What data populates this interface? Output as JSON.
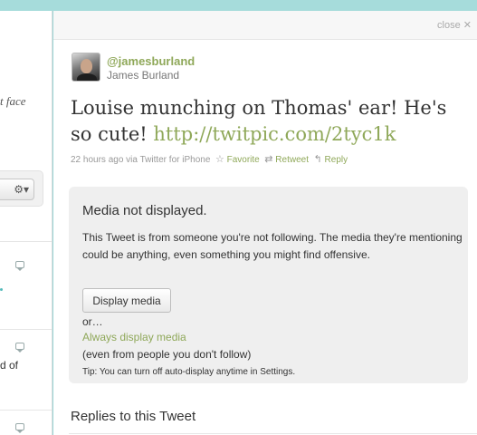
{
  "left_column": {
    "snippet_1": "t face",
    "gear_glyph": "⚙▾",
    "snippet_2": "d of"
  },
  "details": {
    "close_label": "close ✕",
    "author": {
      "screen_name": "@jamesburland",
      "full_name": "James Burland"
    },
    "tweet": {
      "text": "Louise munching on Thomas' ear! He's so cute! ",
      "link": "http://twitpic.com/2tyc1k"
    },
    "meta": {
      "time": "22 hours ago",
      "via_prefix": " via ",
      "client": "Twitter for iPhone",
      "favorite_icon": "☆",
      "favorite_label": "Favorite",
      "retweet_icon": "⇄",
      "retweet_label": "Retweet",
      "reply_icon": "↰",
      "reply_label": "Reply"
    },
    "media_notice": {
      "title": "Media not displayed.",
      "description": "This Tweet is from someone you're not following. The media they're mentioning could be anything, even something you might find offensive.",
      "button_label": "Display media",
      "or_text": "or…",
      "always_link": "Always display media",
      "even_text": "(even from people you don't follow)",
      "tip": "Tip: You can turn off auto-display anytime in Settings."
    },
    "replies_heading": "Replies to this Tweet"
  }
}
